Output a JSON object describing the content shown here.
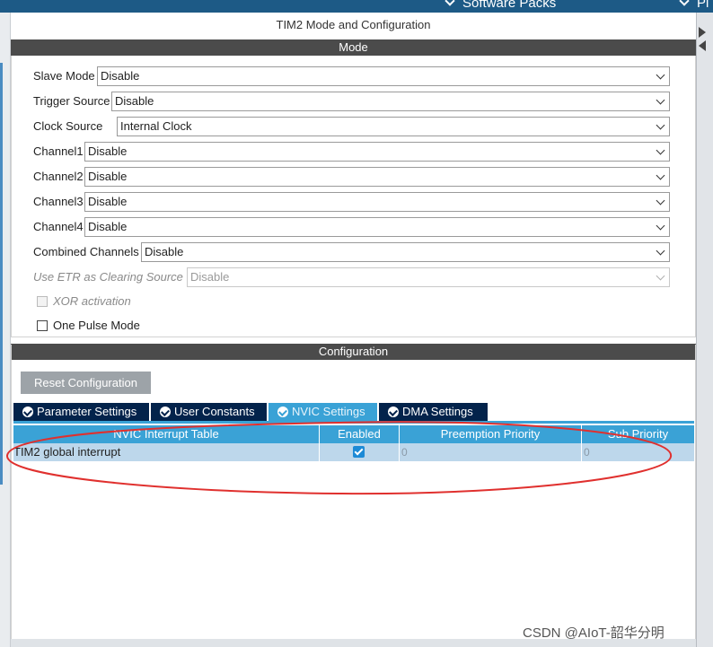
{
  "topbar": {
    "software_packs": "Software Packs",
    "pinout_partial": "Pi"
  },
  "panel": {
    "title": "TIM2 Mode and Configuration"
  },
  "mode": {
    "header": "Mode",
    "fields": [
      {
        "label": "Slave Mode",
        "value": "Disable"
      },
      {
        "label": "Trigger Source",
        "value": "Disable"
      },
      {
        "label": "Clock Source",
        "value": "Internal Clock"
      },
      {
        "label": "Channel1",
        "value": "Disable"
      },
      {
        "label": "Channel2",
        "value": "Disable"
      },
      {
        "label": "Channel3",
        "value": "Disable"
      },
      {
        "label": "Channel4",
        "value": "Disable"
      },
      {
        "label": "Combined Channels",
        "value": "Disable"
      },
      {
        "label": "Use ETR as Clearing Source",
        "value": "Disable"
      }
    ],
    "xor_activation": {
      "label": "XOR activation",
      "checked": false,
      "enabled": false
    },
    "one_pulse_mode": {
      "label": "One Pulse Mode",
      "checked": false,
      "enabled": true
    }
  },
  "configuration": {
    "header": "Configuration",
    "reset_button": "Reset Configuration",
    "tabs": [
      {
        "label": "Parameter Settings",
        "active": false
      },
      {
        "label": "User Constants",
        "active": false
      },
      {
        "label": "NVIC Settings",
        "active": true
      },
      {
        "label": "DMA Settings",
        "active": false
      }
    ],
    "nvic_table": {
      "columns": [
        "NVIC Interrupt Table",
        "Enabled",
        "Preemption Priority",
        "Sub Priority"
      ],
      "rows": [
        {
          "name": "TIM2 global interrupt",
          "enabled": true,
          "preemption_priority": "0",
          "sub_priority": "0"
        }
      ]
    }
  },
  "annotation_color": "#e0302e",
  "accent_color": "#3aa2d6",
  "watermark": "CSDN @AIoT-韶华分明"
}
